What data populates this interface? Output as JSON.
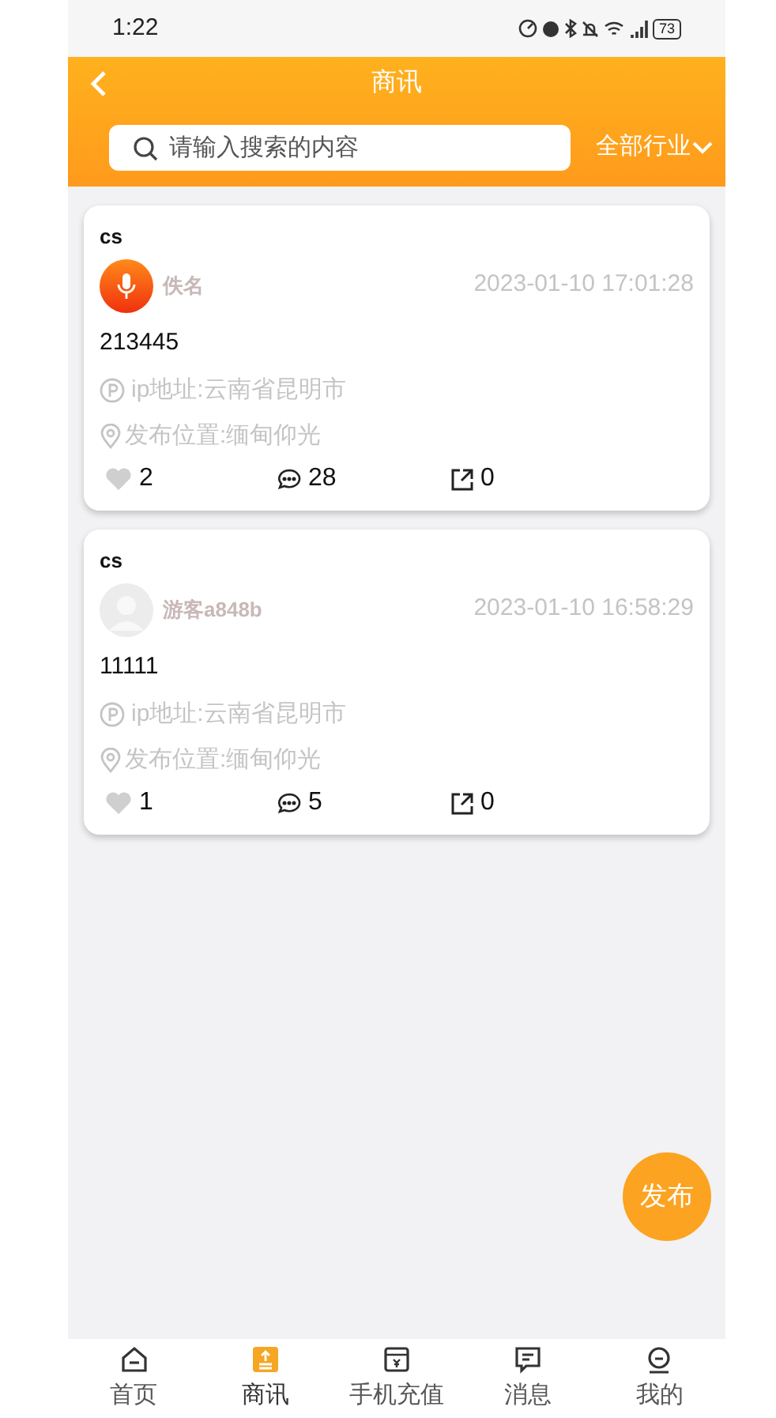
{
  "status_bar": {
    "time": "1:22",
    "battery": "73"
  },
  "header": {
    "title": "商讯",
    "search": {
      "placeholder": "请输入搜索的内容"
    },
    "filter": "全部行业"
  },
  "posts": [
    {
      "title": "cs",
      "avatar": {
        "kind": "mic"
      },
      "author": "佚名",
      "time": "2023-01-10 17:01:28",
      "content": "213445",
      "ip": "ip地址:云南省昆明市",
      "location": "发布位置:缅甸仰光",
      "likes": "2",
      "comments": "28",
      "shares": "0"
    },
    {
      "title": "cs",
      "avatar": {
        "kind": "person"
      },
      "author": "游客a848b",
      "time": "2023-01-10 16:58:29",
      "content": "11111",
      "ip": "ip地址:云南省昆明市",
      "location": "发布位置:缅甸仰光",
      "likes": "1",
      "comments": "5",
      "shares": "0"
    }
  ],
  "fab": "发布",
  "tab_bar": [
    {
      "label": "首页",
      "selected": false
    },
    {
      "label": "商讯",
      "selected": true
    },
    {
      "label": "手机充值",
      "selected": false
    },
    {
      "label": "消息",
      "selected": false
    },
    {
      "label": "我的",
      "selected": false
    }
  ]
}
